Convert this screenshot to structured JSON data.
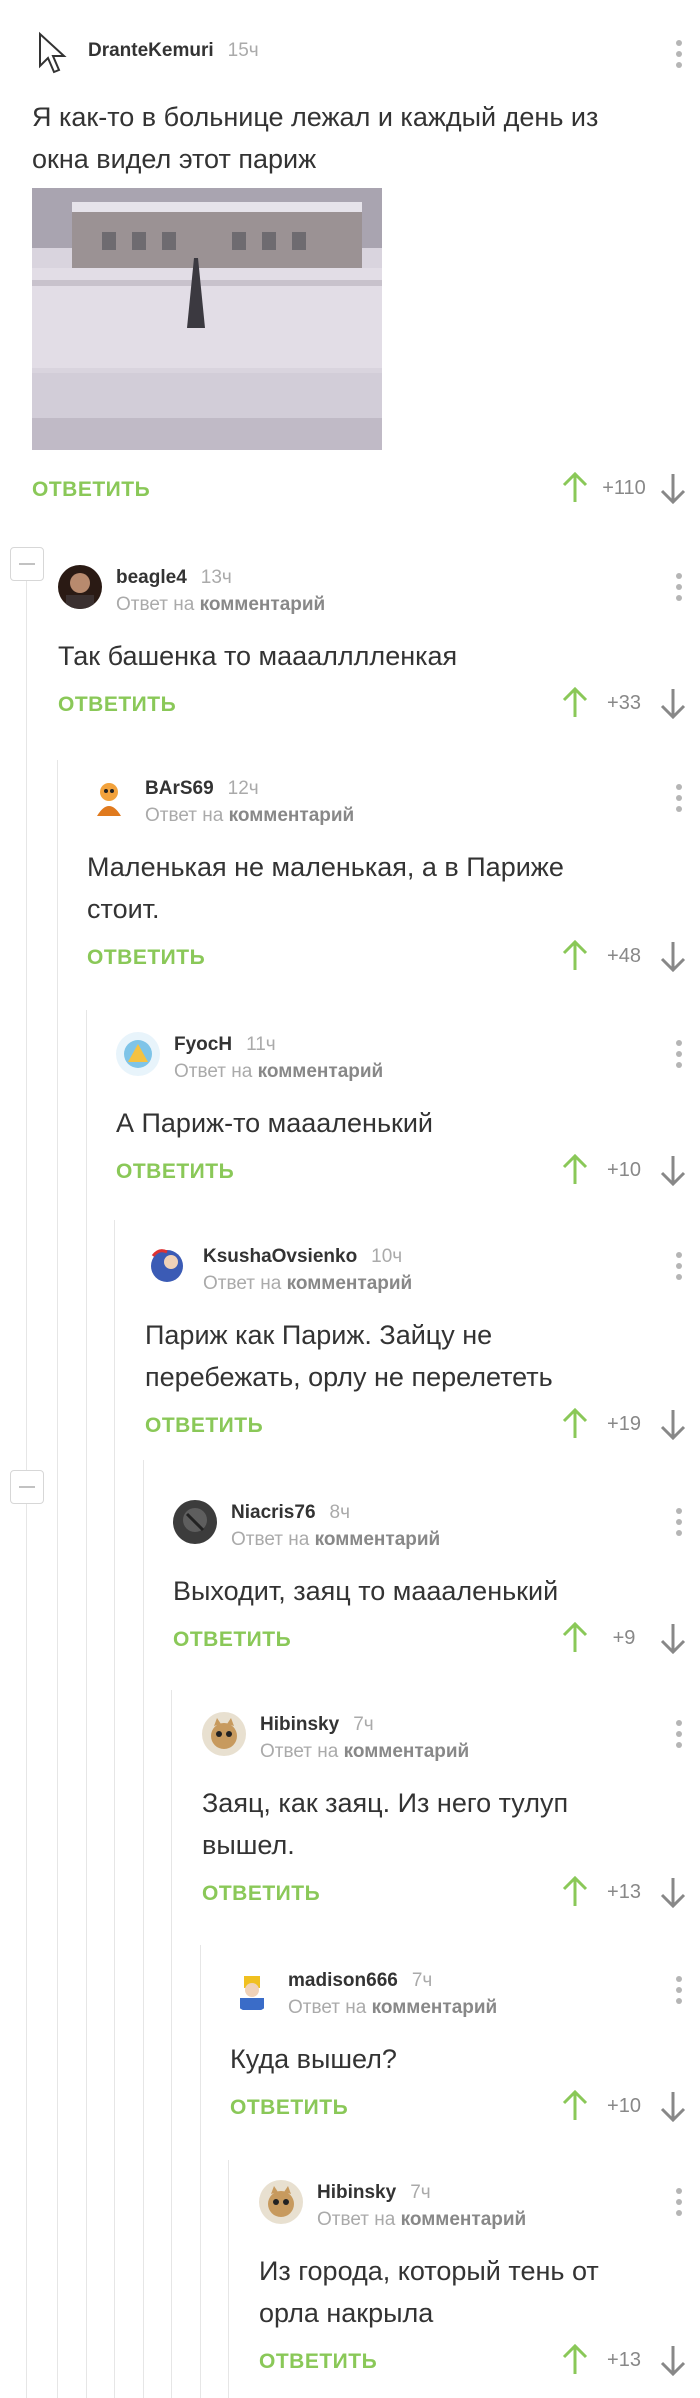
{
  "comments": [
    {
      "author": "DranteKemuri",
      "time": "15ч",
      "text": "Я как-то в больнице лежал и каждый день из окна видел этот париж",
      "reply": "ОТВЕТИТЬ",
      "rating": "+110"
    },
    {
      "author": "beagle4",
      "time": "13ч",
      "reply_prefix": "Ответ на",
      "reply_target": "комментарий",
      "text": "Так башенка то мааалллленкая",
      "reply": "ОТВЕТИТЬ",
      "rating": "+33"
    },
    {
      "author": "BArS69",
      "time": "12ч",
      "reply_prefix": "Ответ на",
      "reply_target": "комментарий",
      "text": "Маленькая не маленькая, а в Париже стоит.",
      "reply": "ОТВЕТИТЬ",
      "rating": "+48"
    },
    {
      "author": "FyocH",
      "time": "11ч",
      "reply_prefix": "Ответ на",
      "reply_target": "комментарий",
      "text": "А Париж-то маааленький",
      "reply": "ОТВЕТИТЬ",
      "rating": "+10"
    },
    {
      "author": "KsushaOvsienko",
      "time": "10ч",
      "reply_prefix": "Ответ на",
      "reply_target": "комментарий",
      "text": "Париж как Париж. Зайцу не перебежать, орлу не перелететь",
      "reply": "ОТВЕТИТЬ",
      "rating": "+19"
    },
    {
      "author": "Niacris76",
      "time": "8ч",
      "reply_prefix": "Ответ на",
      "reply_target": "комментарий",
      "text": "Выходит, заяц то маааленький",
      "reply": "ОТВЕТИТЬ",
      "rating": "+9"
    },
    {
      "author": "Hibinsky",
      "time": "7ч",
      "reply_prefix": "Ответ на",
      "reply_target": "комментарий",
      "text": "Заяц, как заяц. Из него тулуп вышел.",
      "reply": "ОТВЕТИТЬ",
      "rating": "+13"
    },
    {
      "author": "madison666",
      "time": "7ч",
      "reply_prefix": "Ответ на",
      "reply_target": "комментарий",
      "text": "Куда вышел?",
      "reply": "ОТВЕТИТЬ",
      "rating": "+10"
    },
    {
      "author": "Hibinsky",
      "time": "7ч",
      "reply_prefix": "Ответ на",
      "reply_target": "комментарий",
      "text": "Из города, который тень от орла накрыла",
      "reply": "ОТВЕТИТЬ",
      "rating": "+13"
    }
  ],
  "colors": {
    "accent": "#8ac858",
    "text": "#333333",
    "muted": "#aaaaaa"
  },
  "icons": [
    "cursor-arrow-icon",
    "more-vertical-icon",
    "arrow-up-icon",
    "arrow-down-icon",
    "collapse-thread-icon"
  ]
}
